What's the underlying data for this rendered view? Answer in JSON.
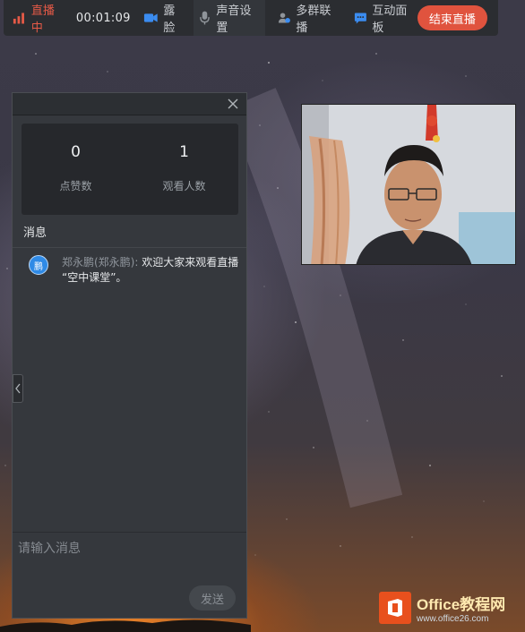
{
  "toolbar": {
    "live_status": "直播中",
    "timer": "00:01:09",
    "camera_label": "露脸",
    "audio_label": "声音设置",
    "multigroup_label": "多群联播",
    "board_label": "互动面板",
    "end_label": "结束直播"
  },
  "stats": {
    "likes_value": "0",
    "likes_label": "点赞数",
    "viewers_value": "1",
    "viewers_label": "观看人数"
  },
  "messages": {
    "title": "消息",
    "items": [
      {
        "avatar_text": "鹏",
        "sender": "郑永鹏(郑永鹏):",
        "text": "欢迎大家来观看直播 “空中课堂”。"
      }
    ]
  },
  "input": {
    "placeholder": "请输入消息",
    "send_label": "发送"
  },
  "watermark": {
    "title": "Office教程网",
    "url": "www.office26.com"
  },
  "colors": {
    "accent": "#e0533e",
    "toolbar_bg": "#2b2d31",
    "panel_bg": "#35383d",
    "icon_blue": "#3b8cf0"
  }
}
